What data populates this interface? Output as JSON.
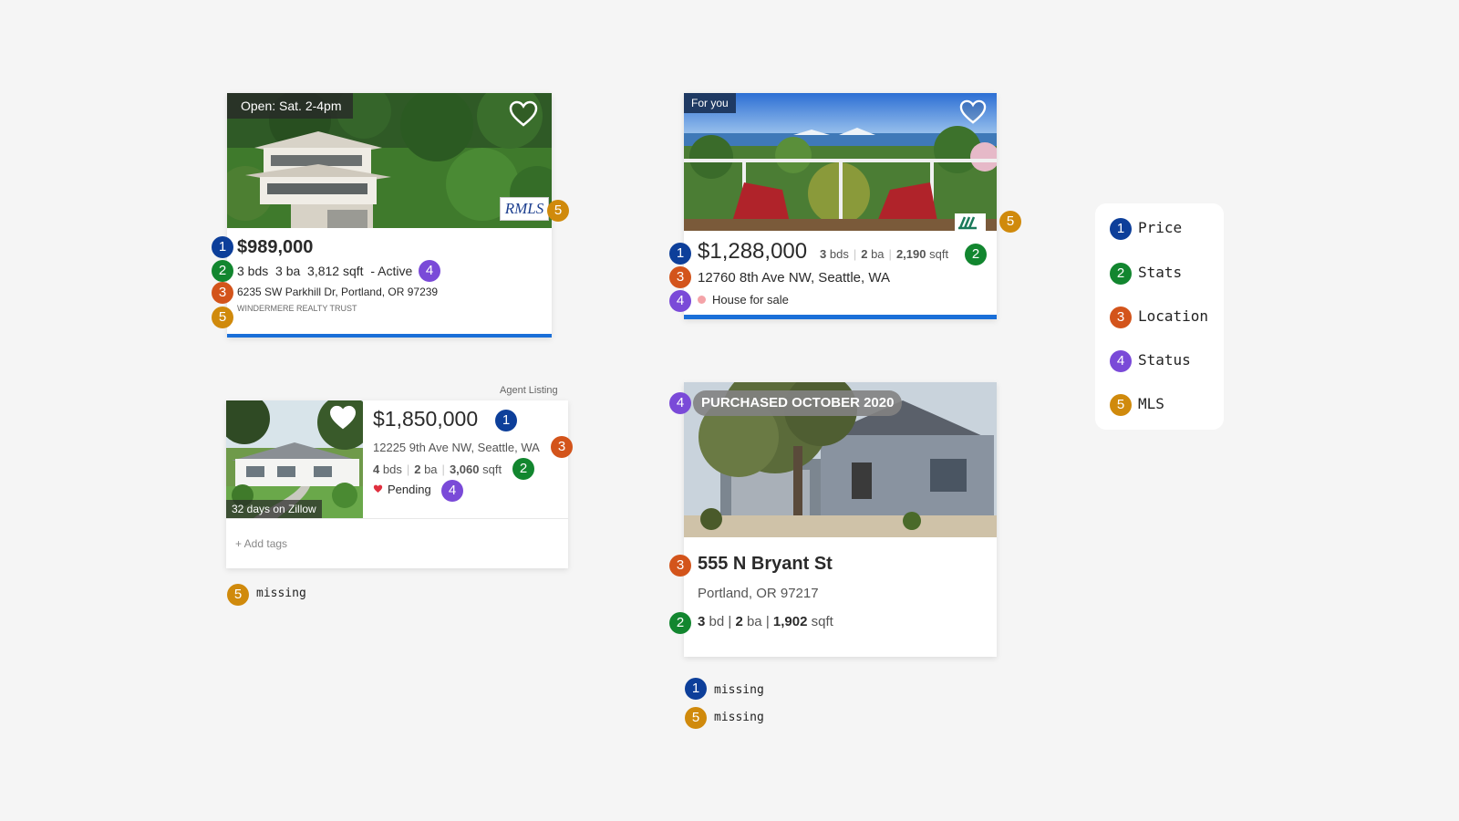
{
  "card1": {
    "open_tag": "Open: Sat. 2-4pm",
    "mls_logo": "RMLS",
    "price": "$989,000",
    "stats": "3 bds  3 ba  3,812 sqft  - Active",
    "address": "6235 SW Parkhill Dr, Portland, OR 97239",
    "brokerage": "WINDERMERE REALTY TRUST",
    "accent_color": "#1a6fd8"
  },
  "card2": {
    "tag": "For you",
    "price": "$1,288,000",
    "beds": "3",
    "beds_unit": "bds",
    "baths": "2",
    "baths_unit": "ba",
    "sqft": "2,190",
    "sqft_unit": "sqft",
    "address": "12760 8th Ave NW, Seattle, WA",
    "status": "House for sale",
    "status_color": "#f4a3a8",
    "accent_color": "#1a6fd8"
  },
  "card3": {
    "agent_label": "Agent Listing",
    "days": "32 days on Zillow",
    "price": "$1,850,000",
    "address": "12225 9th Ave NW, Seattle, WA",
    "beds": "4",
    "beds_unit": "bds",
    "baths": "2",
    "baths_unit": "ba",
    "sqft": "3,060",
    "sqft_unit": "sqft",
    "status": "Pending",
    "status_icon": "heart-icon",
    "add_tags": "+ Add tags"
  },
  "card4": {
    "banner": "PURCHASED OCTOBER 2020",
    "street": "555 N Bryant St",
    "city": "Portland, OR 97217",
    "beds": "3",
    "beds_unit": "bd",
    "baths": "2",
    "baths_unit": "ba",
    "sqft": "1,902",
    "sqft_unit": "sqft",
    "divider": "|"
  },
  "notes": {
    "card3_missing_5": "missing",
    "card4_missing_1": "missing",
    "card4_missing_5": "missing"
  },
  "badge_numbers": [
    "1",
    "2",
    "3",
    "4",
    "5"
  ],
  "legend": [
    {
      "num": "1",
      "label": "Price",
      "color": "#0d3f9a"
    },
    {
      "num": "2",
      "label": "Stats",
      "color": "#12862f"
    },
    {
      "num": "3",
      "label": "Location",
      "color": "#d3541b"
    },
    {
      "num": "4",
      "label": "Status",
      "color": "#7a4ad8"
    },
    {
      "num": "5",
      "label": "MLS",
      "color": "#d08a0c"
    }
  ]
}
